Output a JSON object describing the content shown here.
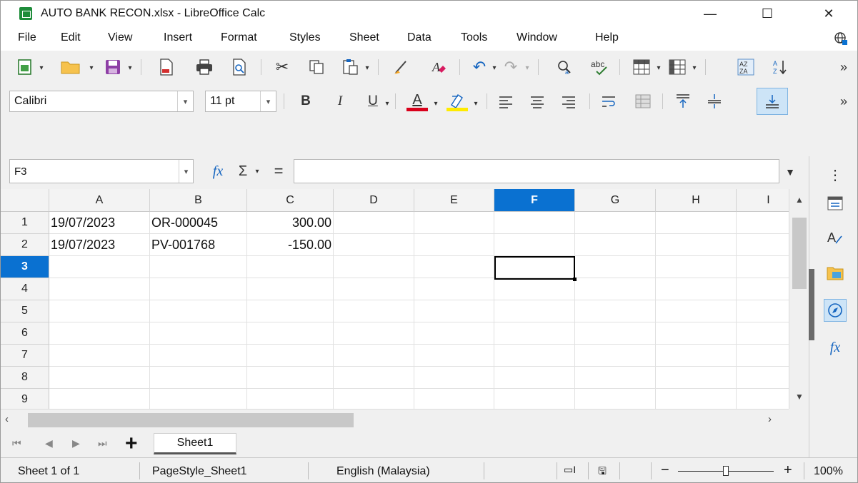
{
  "window": {
    "title": "AUTO BANK RECON.xlsx - LibreOffice Calc",
    "minimize": "—",
    "maximize": "☐",
    "close": "✕"
  },
  "menu": [
    "File",
    "Edit",
    "View",
    "Insert",
    "Format",
    "Styles",
    "Sheet",
    "Data",
    "Tools",
    "Window",
    "Help"
  ],
  "format_toolbar": {
    "font_name": "Calibri",
    "font_size": "11 pt",
    "bold": "B",
    "italic": "I",
    "underline": "U",
    "font_color_letter": "A",
    "font_color": "#d9001b",
    "highlight_color": "#ffeb00"
  },
  "formula_bar": {
    "name_box": "F3",
    "fx": "fx",
    "sum": "Σ",
    "equals": "=",
    "content": ""
  },
  "sheet": {
    "columns": [
      "A",
      "B",
      "C",
      "D",
      "E",
      "F",
      "G",
      "H",
      "I"
    ],
    "rows": [
      "1",
      "2",
      "3",
      "4",
      "5",
      "6",
      "7",
      "8",
      "9"
    ],
    "active_column": "F",
    "active_row": "3",
    "active_cell": "F3",
    "cells": {
      "r1": {
        "a": "19/07/2023",
        "b": "OR-000045",
        "c": "300.00"
      },
      "r2": {
        "a": "19/07/2023",
        "b": "PV-001768",
        "c": "-150.00"
      }
    }
  },
  "tabs": {
    "add": "+",
    "sheets": [
      "Sheet1"
    ]
  },
  "status": {
    "sheet_position": "Sheet 1 of 1",
    "page_style": "PageStyle_Sheet1",
    "language": "English (Malaysia)",
    "zoom_minus": "−",
    "zoom_plus": "+",
    "zoom": "100%"
  },
  "icons": {
    "accent": "#0a71d1"
  }
}
